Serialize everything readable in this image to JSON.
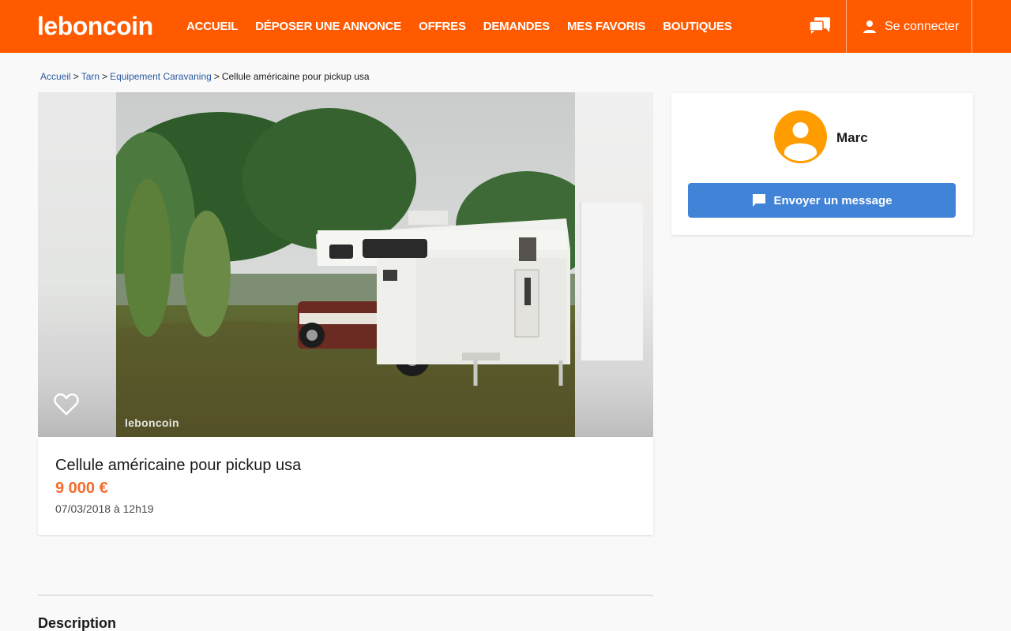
{
  "header": {
    "logo": "leboncoin",
    "nav": [
      "ACCUEIL",
      "DÉPOSER UNE ANNONCE",
      "OFFRES",
      "DEMANDES",
      "MES FAVORIS",
      "BOUTIQUES"
    ],
    "login_label": "Se connecter"
  },
  "breadcrumb": {
    "items": [
      "Accueil",
      "Tarn",
      "Equipement Caravaning"
    ],
    "separator": ">",
    "current": "Cellule américaine pour pickup usa"
  },
  "gallery": {
    "watermark": "leboncoin"
  },
  "ad": {
    "title": "Cellule américaine pour pickup usa",
    "price": "9 000 €",
    "date": "07/03/2018 à 12h19"
  },
  "description": {
    "heading": "Description"
  },
  "seller": {
    "name": "Marc",
    "message_button": "Envoyer un message"
  },
  "colors": {
    "brand": "#ff5a00",
    "price": "#f56b2a",
    "button": "#4183d7",
    "avatar": "#ff9d00",
    "link": "#2a5aa0"
  }
}
